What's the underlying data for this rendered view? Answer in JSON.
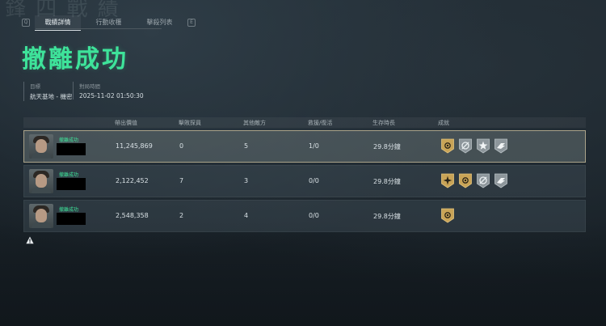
{
  "background_title": "鋒 四 戰 績",
  "tabs": [
    {
      "label": "戰績詳情",
      "active": true
    },
    {
      "label": "行動收穫",
      "active": false
    },
    {
      "label": "擊殺列表",
      "active": false
    }
  ],
  "key_hints": {
    "left": "Q",
    "right": "E"
  },
  "title": "撤離成功",
  "meta": {
    "target_label": "目標",
    "target_value": "航天基地 - 機密",
    "time_label": "對局時間",
    "time_value": "2025-11-02 01:50:30"
  },
  "columns": [
    "帶出價值",
    "擊敗探員",
    "其他敵方",
    "救援/復活",
    "生存時長",
    "成就"
  ],
  "rows": [
    {
      "status": "撤離成功",
      "value": "11,245,869",
      "kills": "0",
      "others": "5",
      "rescue": "1/0",
      "survival": "29.8分鐘",
      "badges": [
        "gold-sun-badge",
        "silver-ring-badge",
        "silver-star-badge",
        "silver-wing-badge"
      ],
      "highlighted": true
    },
    {
      "status": "撤離成功",
      "value": "2,122,452",
      "kills": "7",
      "others": "3",
      "rescue": "0/0",
      "survival": "29.8分鐘",
      "badges": [
        "gold-burst-badge",
        "gold-sun-badge",
        "silver-ring-badge",
        "silver-wing-badge"
      ],
      "highlighted": false
    },
    {
      "status": "撤離成功",
      "value": "2,548,358",
      "kills": "2",
      "others": "4",
      "rescue": "0/0",
      "survival": "29.8分鐘",
      "badges": [
        "gold-sun-badge"
      ],
      "highlighted": false
    }
  ],
  "icons": {
    "warning": "warning-icon"
  },
  "colors": {
    "accent": "#3ee39a",
    "gold": "#c9a457",
    "silver": "#8d969b"
  }
}
